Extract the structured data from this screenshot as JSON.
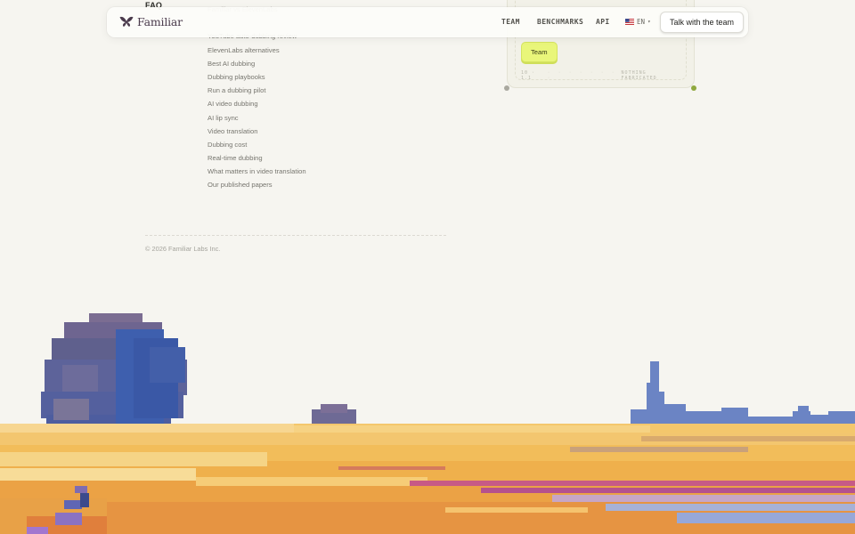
{
  "header": {
    "brand": "Familiar",
    "nav": [
      {
        "label": "TEAM"
      },
      {
        "label": "BENCHMARKS"
      },
      {
        "label": "API"
      }
    ],
    "language": "EN",
    "cta_label": "Talk with the team"
  },
  "card": {
    "chip_label": "Team",
    "meta_left": "10 · 1.1",
    "meta_right": "NOTHING FABRICATED"
  },
  "footer": {
    "faq_heading": "FAQ",
    "links": [
      "Familiar vs ElevenLabs",
      "",
      "YouTube auto-dubbing review",
      "ElevenLabs alternatives",
      "Best AI dubbing",
      "Dubbing playbooks",
      "Run a dubbing pilot",
      "AI video dubbing",
      "AI lip sync",
      "Video translation",
      "Dubbing cost",
      "Real-time dubbing",
      "What matters in video translation",
      "Our published papers"
    ],
    "copyright": "© 2026 Familiar Labs Inc."
  },
  "colors": {
    "background": "#f6f5f0",
    "chip": "#e9f67a",
    "field": "#f7c25e",
    "tree": "#3e5fae",
    "accent_dot": "#8fa83e"
  },
  "icons": {
    "logo": "butterfly-icon",
    "flag": "us-flag-icon",
    "dropdown": "chevron-down-icon"
  }
}
